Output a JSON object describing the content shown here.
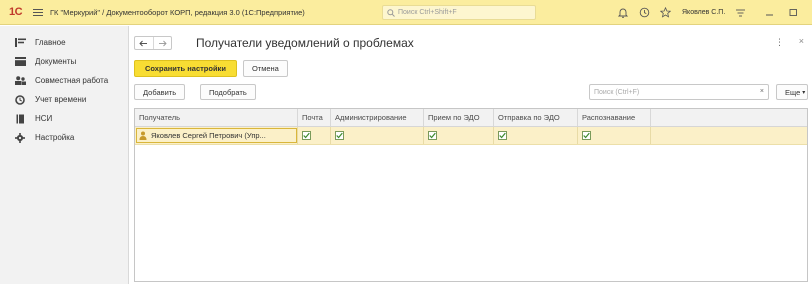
{
  "titlebar": {
    "logo": "1С",
    "title": "ГК \"Меркурий\" / Документооборот КОРП, редакция 3.0  (1С:Предприятие)",
    "search_placeholder": "Поиск Ctrl+Shift+F",
    "user": "Яковлев С.П."
  },
  "sidebar": {
    "items": [
      {
        "label": "Главное",
        "icon": "menu-lines-icon"
      },
      {
        "label": "Документы",
        "icon": "documents-icon"
      },
      {
        "label": "Совместная работа",
        "icon": "people-icon"
      },
      {
        "label": "Учет времени",
        "icon": "clock-icon"
      },
      {
        "label": "НСИ",
        "icon": "book-icon"
      },
      {
        "label": "Настройка",
        "icon": "gear-icon"
      }
    ]
  },
  "form": {
    "title": "Получатели уведомлений о проблемах",
    "save_label": "Сохранить настройки",
    "cancel_label": "Отмена",
    "add_label": "Добавить",
    "pick_label": "Подобрать",
    "search_placeholder": "Поиск (Ctrl+F)",
    "more_label": "Еще"
  },
  "table": {
    "columns": [
      "Получатель",
      "Почта",
      "Администрирование",
      "Прием по ЭДО",
      "Отправка по ЭДО",
      "Распознавание"
    ],
    "rows": [
      {
        "recipient": "Яковлев Сергей Петрович (Упр...",
        "mail": true,
        "admin": true,
        "edo_in": true,
        "edo_out": true,
        "recognition": true
      }
    ]
  },
  "colors": {
    "titlebar": "#fbed9e",
    "primary_button": "#f8dd33",
    "selected_row": "#fbf0c8",
    "check": "#3c8a2e"
  }
}
